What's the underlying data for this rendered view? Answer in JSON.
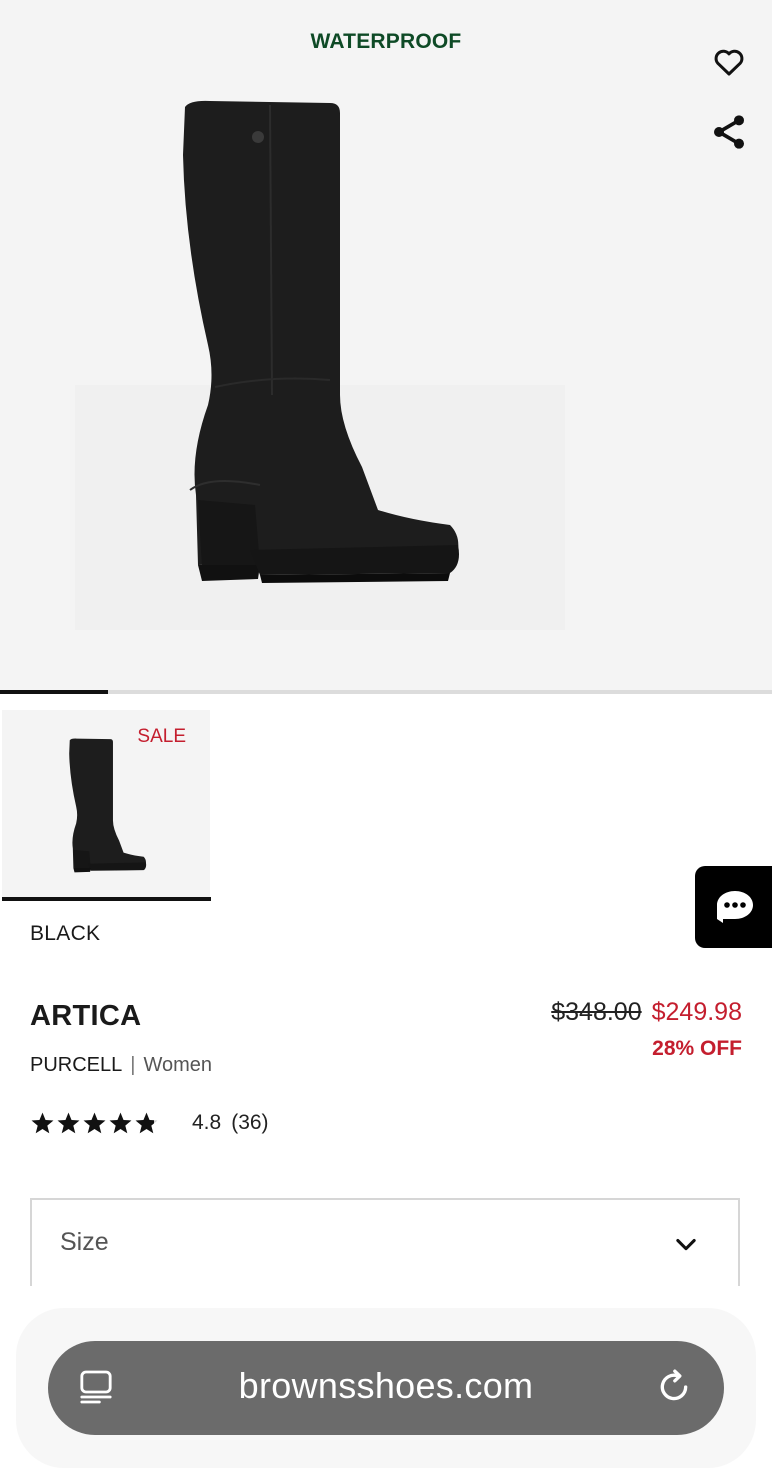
{
  "hero": {
    "badge": "WATERPROOF",
    "badge_color": "#0e4a26",
    "gallery_progress": 0.14
  },
  "icons": {
    "wishlist": "heart-outline-icon",
    "share": "share-icon",
    "chat": "chat-bubble-icon",
    "chevron": "chevron-down-icon",
    "reader": "reader-mode-icon",
    "reload": "reload-icon"
  },
  "thumbnail": {
    "badge": "SALE",
    "badge_color": "#c41e2e"
  },
  "product": {
    "color": "BLACK",
    "name": "ARTICA",
    "brand": "PURCELL",
    "separator": "|",
    "category": "Women",
    "price_original": "$348.00",
    "price_sale": "$249.98",
    "discount": "28% OFF",
    "rating": {
      "value": "4.8",
      "count": "(36)",
      "stars": 4.8,
      "max_stars": 5
    }
  },
  "size_select": {
    "label": "Size"
  },
  "browser": {
    "url": "brownsshoes.com"
  }
}
